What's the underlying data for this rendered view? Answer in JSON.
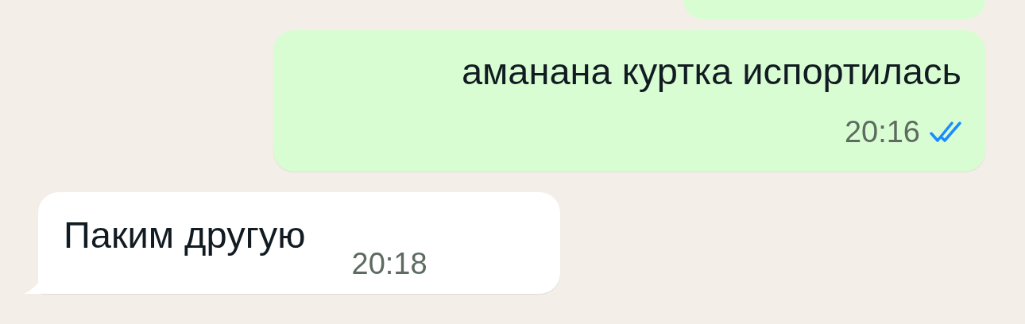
{
  "messages": [
    {
      "kind": "outgoing",
      "text": "аманана куртка испортилась",
      "time": "20:16",
      "read": true
    },
    {
      "kind": "incoming",
      "text": "Паким другую",
      "time": "20:18"
    }
  ]
}
